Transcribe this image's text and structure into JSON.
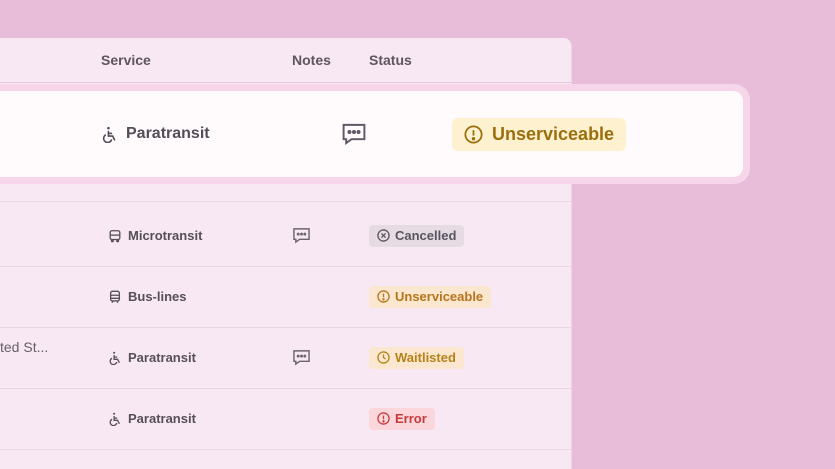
{
  "columns": {
    "service": "Service",
    "notes": "Notes",
    "status": "Status"
  },
  "highlight": {
    "service": "Paratransit",
    "service_icon": "wheelchair-icon",
    "has_note": true,
    "status": "Unserviceable",
    "status_icon": "alert-circle-icon"
  },
  "rows": [
    {
      "address": "",
      "service": "Microtransit",
      "service_icon": "van-icon",
      "has_note": true,
      "status": "Cancelled",
      "status_icon": "x-circle-icon"
    },
    {
      "address": "",
      "service": "Bus-lines",
      "service_icon": "bus-icon",
      "has_note": false,
      "status": "Unserviceable",
      "status_icon": "alert-circle-icon"
    },
    {
      "address": "ted St...",
      "service": "Paratransit",
      "service_icon": "wheelchair-icon",
      "has_note": true,
      "status": "Waitlisted",
      "status_icon": "clock-icon"
    },
    {
      "address": "",
      "service": "Paratransit",
      "service_icon": "wheelchair-icon",
      "has_note": false,
      "status": "Error",
      "status_icon": "alert-circle-icon"
    }
  ],
  "colors": {
    "background": "#e8bdd9",
    "table": "#f8e8f3",
    "unserviceable": "#fdf1cf",
    "error": "#fbd7dc"
  }
}
